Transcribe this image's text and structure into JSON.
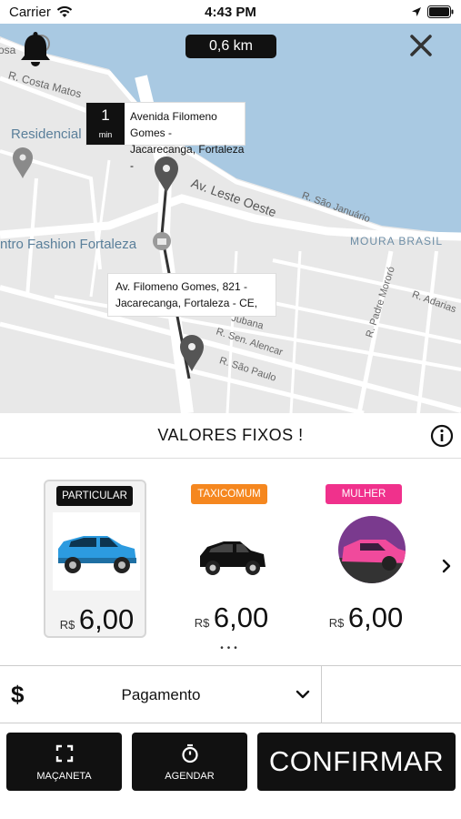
{
  "status_bar": {
    "carrier": "Carrier",
    "time": "4:43 PM"
  },
  "map": {
    "distance": "0,6 km",
    "labels": {
      "osa": "osa",
      "r_costa_matos": "R. Costa Matos",
      "residencial": "Residencial",
      "av_leste_oeste": "Av. Leste Oeste",
      "r_sao_januario": "R. São Januário",
      "shopping": "ntro Fashion Fortaleza",
      "moura_brasil": "MOURA BRASIL",
      "r_padre_mororo": "R. Padre Mororó",
      "r_adarias": "R. Adarias",
      "r_jubana": "Jubana",
      "r_sen_alencar": "R. Sen. Alencar",
      "r_sao_paulo": "R. São Paulo"
    },
    "eta": {
      "value": "1",
      "unit": "min",
      "address_line1": "Avenida Filomeno Gomes -",
      "address_line2": "Jacarecanga, Fortaleza -"
    },
    "destination": {
      "address_line1": "Av. Filomeno Gomes, 821 -",
      "address_line2": "Jacarecanga, Fortaleza - CE,"
    }
  },
  "title": "VALORES FIXOS !",
  "vehicles": [
    {
      "badge": "PARTICULAR",
      "currency": "R$",
      "price": "6,00",
      "badge_color": "#111111",
      "selected": true
    },
    {
      "badge": "TAXICOMUM",
      "currency": "R$",
      "price": "6,00",
      "badge_color": "#f5871f",
      "selected": false
    },
    {
      "badge": "MULHER",
      "currency": "R$",
      "price": "6,00",
      "badge_color": "#f0318c",
      "selected": false
    }
  ],
  "pagination": "•••",
  "payment": {
    "symbol": "$",
    "label": "Pagamento"
  },
  "actions": {
    "macaneta": "MAÇANETA",
    "agendar": "AGENDAR",
    "confirmar": "CONFIRMAR"
  },
  "colors": {
    "water": "#a9c9e2",
    "road": "#ffffff",
    "land": "#e8e8e8",
    "dark": "#111111"
  }
}
